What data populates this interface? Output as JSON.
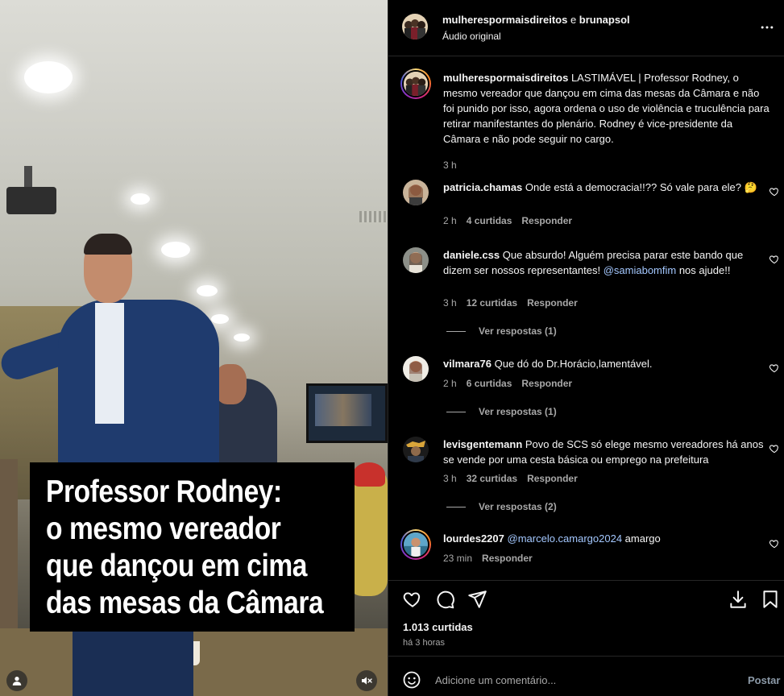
{
  "video": {
    "caption_lines": [
      "Professor Rodney:",
      "o mesmo vereador",
      "que dançou em cima",
      "das mesas da Câmara"
    ],
    "user_icon": "user-tag-icon",
    "mute_icon": "muted-speaker-icon"
  },
  "header": {
    "user1": "mulherespormaisdireitos",
    "connector": " e ",
    "user2": "brunapsol",
    "subtitle": "Áudio original",
    "more_icon": "more-horizontal-icon"
  },
  "post": {
    "username": "mulherespormaisdireitos",
    "text": "LASTIMÁVEL | Professor Rodney, o mesmo vereador que dançou em cima das mesas da Câmara e não foi punido por isso, agora ordena o uso de violência e truculência para retirar manifestantes do plenário. Rodney é vice-presidente da Câmara e não pode seguir no cargo.",
    "time": "3 h"
  },
  "comments": [
    {
      "username": "patricia.chamas",
      "text": "Onde está a democracia!!?? Só vale para ele? 🤔",
      "time": "2 h",
      "likes": "4 curtidas",
      "reply": "Responder",
      "view_replies": ""
    },
    {
      "username": "daniele.css",
      "text_before": "Que absurdo! Alguém precisa parar este bando que dizem ser nossos representantes! ",
      "mention": "@samiabomfim",
      "text_after": " nos ajude!!",
      "time": "3 h",
      "likes": "12 curtidas",
      "reply": "Responder",
      "view_replies": "Ver respostas (1)"
    },
    {
      "username": "vilmara76",
      "text": "Que dó do Dr.Horácio,lamentável.",
      "time": "2 h",
      "likes": "6 curtidas",
      "reply": "Responder",
      "view_replies": "Ver respostas (1)"
    },
    {
      "username": "levisgentemann",
      "text": "Povo de SCS só elege mesmo vereadores há anos se vende por uma cesta básica ou emprego na prefeitura",
      "time": "3 h",
      "likes": "32 curtidas",
      "reply": "Responder",
      "view_replies": "Ver respostas (2)"
    },
    {
      "username": "lourdes2207",
      "mention": "@marcelo.camargo2024",
      "text_after": " amargo",
      "time": "23 min",
      "reply": "Responder"
    }
  ],
  "actions": {
    "like_icon": "heart-icon",
    "comment_icon": "comment-icon",
    "share_icon": "send-icon",
    "download_icon": "download-icon",
    "save_icon": "bookmark-icon",
    "likes": "1.013 curtidas",
    "time": "há 3 horas"
  },
  "add_comment": {
    "emoji_icon": "emoji-icon",
    "placeholder": "Adicione um comentário...",
    "post_label": "Postar"
  },
  "colors": {
    "background": "#000000",
    "text": "#f5f5f5",
    "secondary_text": "#a8a8a8",
    "mention": "#e0f1ff",
    "divider": "#262626"
  }
}
